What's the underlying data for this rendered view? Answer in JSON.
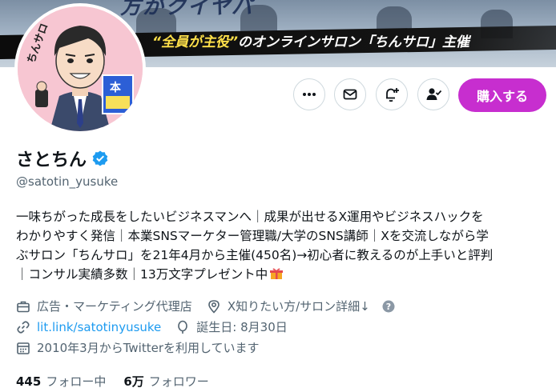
{
  "banner": {
    "top_text": "方がクイヤパ",
    "tagline_highlight": "“全員が主役”",
    "tagline_rest": "のオンラインサロン「ちんサロ」主催"
  },
  "avatar": {
    "label": "ちんサロ",
    "book_char": "本"
  },
  "actions": {
    "more_icon": "more-icon",
    "message_icon": "envelope-icon",
    "subscribe_icon": "bell-plus-icon",
    "follow_icon": "person-check-icon",
    "buy_label": "購入する",
    "buy_color": "#c72ecf"
  },
  "profile": {
    "name": "さとちん",
    "verified_icon": "verified-badge-icon",
    "verified_color": "#1d9bf0",
    "handle": "@satotin_yusuke",
    "bio_lines": [
      "一味ちがった成長をしたいビジネスマンへ｜成果が出せるX運用やビジネスハックを",
      "わかりやすく発信｜本業SNSマーケター管理職/大学のSNS講師｜Xを交流しながら学",
      "ぶサロン「ちんサロ」を21年4月から主催(450名)→初心者に教えるのが上手いと評判",
      "｜コンサル実績多数｜13万文字プレゼント中"
    ],
    "gift_icon": "gift-icon",
    "category": "広告・マーケティング代理店",
    "location": "X知りたい方/サロン詳細↓",
    "website": "lit.link/satotinyusuke",
    "birthday": "誕生日: 8月30日",
    "joined": "2010年3月からTwitterを利用しています"
  },
  "stats": {
    "following_count": "445",
    "following_label": "フォロー中",
    "followers_count": "6万",
    "followers_label": "フォロワー"
  }
}
